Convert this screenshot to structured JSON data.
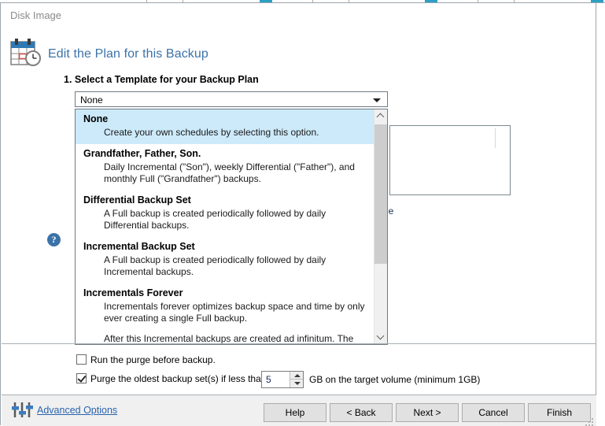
{
  "window": {
    "title": "Disk Image"
  },
  "header": {
    "icon": "calendar-clock-icon",
    "title": "Edit the Plan for this Backup",
    "step_title": "1. Select a Template for your Backup Plan",
    "help_glyph": "?"
  },
  "combo": {
    "selected_value": "None",
    "arrow_icon": "chevron-down-icon"
  },
  "dropdown": {
    "items": [
      {
        "name": "None",
        "desc": "Create your own schedules by selecting this option.",
        "selected": true
      },
      {
        "name": "Grandfather, Father, Son.",
        "desc": "Daily Incremental (\"Son\"), weekly Differential (\"Father\"), and monthly Full (\"Grandfather\") backups.",
        "selected": false
      },
      {
        "name": "Differential Backup Set",
        "desc": "A Full backup is created periodically followed by daily Differential backups.",
        "selected": false
      },
      {
        "name": "Incremental Backup Set",
        "desc": "A Full backup is created periodically followed by daily Incremental backups.",
        "selected": false
      },
      {
        "name": "Incrementals Forever",
        "desc": "Incrementals forever optimizes backup space and time by only ever creating a single Full backup.",
        "desc2": "After this Incremental backups are created ad infinitum. The Full",
        "selected": false
      }
    ],
    "scroll_up_icon": "chevron-up-icon",
    "scroll_down_icon": "chevron-down-icon"
  },
  "right_panel": {
    "clipped_text": "le"
  },
  "options": {
    "purge_before": {
      "label": "Run the purge before backup.",
      "checked": false
    },
    "purge_oldest": {
      "label": "Purge the oldest backup set(s) if less than",
      "checked": true
    },
    "threshold": {
      "value": "5",
      "unit_label": "GB on the target volume (minimum 1GB)",
      "up_icon": "spinner-up-icon",
      "down_icon": "spinner-down-icon"
    }
  },
  "footer": {
    "advanced_icon": "sliders-icon",
    "advanced_label": "Advanced Options",
    "buttons": [
      {
        "label": "Help"
      },
      {
        "label": "< Back"
      },
      {
        "label": "Next >"
      },
      {
        "label": "Cancel"
      },
      {
        "label": "Finish"
      }
    ]
  },
  "colors": {
    "accent": "#3b72a8",
    "link": "#2a63ad",
    "selection": "#cdeafa",
    "panel": "#f0f0f0"
  }
}
